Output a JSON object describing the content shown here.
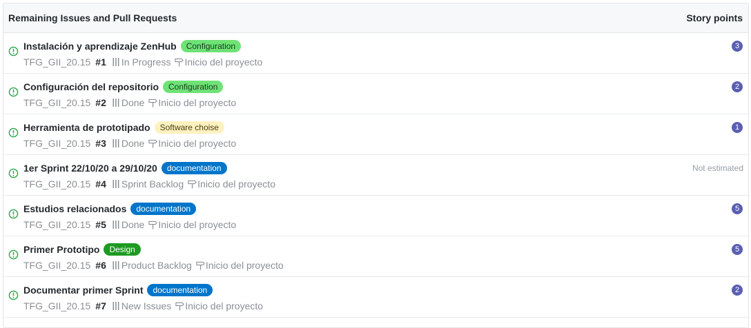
{
  "header": {
    "title": "Remaining Issues and Pull Requests",
    "points_title": "Story points"
  },
  "colors": {
    "status_icon": "#28a745",
    "points_badge": "#5a5fb2",
    "header_bg": "#f6f8fa",
    "border": "#e1e4e8"
  },
  "icons": {
    "status": "issue-opened-icon",
    "pipeline": "pipeline-icon",
    "milestone": "milestone-icon"
  },
  "issues": [
    {
      "title": "Instalación y aprendizaje ZenHub",
      "label": "Configuration",
      "label_bg": "#6ee276",
      "label_fg": "#1b3a1d",
      "repo": "TFG_GII_20.15",
      "number": "#1",
      "pipeline": "In Progress",
      "milestone": "Inicio del proyecto",
      "points": "3"
    },
    {
      "title": "Configuración del repositorio",
      "label": "Configuration",
      "label_bg": "#6ee276",
      "label_fg": "#1b3a1d",
      "repo": "TFG_GII_20.15",
      "number": "#2",
      "pipeline": "Done",
      "milestone": "Inicio del proyecto",
      "points": "2"
    },
    {
      "title": "Herramienta de prototipado",
      "label": "Software choise",
      "label_bg": "#fdf1c0",
      "label_fg": "#4a3f12",
      "repo": "TFG_GII_20.15",
      "number": "#3",
      "pipeline": "Done",
      "milestone": "Inicio del proyecto",
      "points": "1"
    },
    {
      "title": "1er Sprint 22/10/20 a 29/10/20",
      "label": "documentation",
      "label_bg": "#0075ca",
      "label_fg": "#ffffff",
      "repo": "TFG_GII_20.15",
      "number": "#4",
      "pipeline": "Sprint Backlog",
      "milestone": "Inicio del proyecto",
      "points": "Not estimated"
    },
    {
      "title": "Estudios relacionados",
      "label": "documentation",
      "label_bg": "#0075ca",
      "label_fg": "#ffffff",
      "repo": "TFG_GII_20.15",
      "number": "#5",
      "pipeline": "Done",
      "milestone": "Inicio del proyecto",
      "points": "5"
    },
    {
      "title": "Primer Prototipo",
      "label": "Design",
      "label_bg": "#1d9a22",
      "label_fg": "#ffffff",
      "repo": "TFG_GII_20.15",
      "number": "#6",
      "pipeline": "Product Backlog",
      "milestone": "Inicio del proyecto",
      "points": "5"
    },
    {
      "title": "Documentar primer Sprint",
      "label": "documentation",
      "label_bg": "#0075ca",
      "label_fg": "#ffffff",
      "repo": "TFG_GII_20.15",
      "number": "#7",
      "pipeline": "New Issues",
      "milestone": "Inicio del proyecto",
      "points": "2"
    }
  ]
}
